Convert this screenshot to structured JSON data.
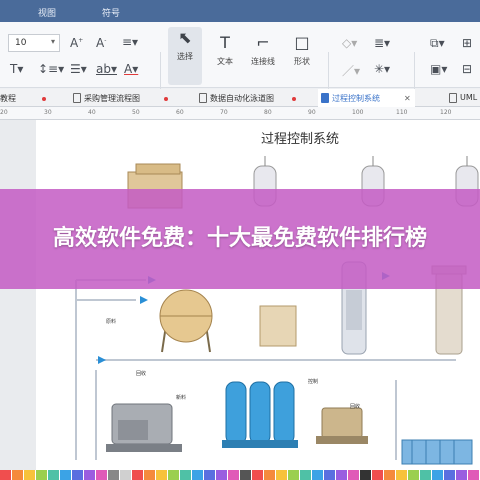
{
  "menu": {
    "items": [
      "视图",
      "符号"
    ]
  },
  "toolbar": {
    "font_size": "10",
    "tools": [
      {
        "label": "选择",
        "icon": "pointer-icon"
      },
      {
        "label": "文本",
        "icon": "text-tool-icon"
      },
      {
        "label": "连接线",
        "icon": "connector-icon"
      },
      {
        "label": "形状",
        "icon": "shape-icon"
      }
    ]
  },
  "tabs": [
    {
      "label": "教程",
      "modified": true
    },
    {
      "label": "采购管理流程图",
      "modified": true
    },
    {
      "label": "数据自动化泳道图",
      "modified": true
    },
    {
      "label": "过程控制系统",
      "active": true
    },
    {
      "label": "UML"
    }
  ],
  "ruler": {
    "ticks": [
      "20",
      "30",
      "40",
      "50",
      "60",
      "70",
      "80",
      "90",
      "100",
      "110",
      "120"
    ]
  },
  "diagram": {
    "title": "过程控制系统",
    "labels": [
      "原料",
      "回收",
      "新料",
      "控制",
      "回收"
    ]
  },
  "banner": {
    "text": "高效软件免费：十大最免费软件排行榜"
  },
  "colors": {
    "menubar": "#4a6b9a",
    "active_tab": "#3a73c9",
    "banner": "#c45cc4",
    "flow_arrow": "#2a8fd6",
    "palette": [
      "#f04e4e",
      "#f58a3c",
      "#f7c23b",
      "#9bcf4e",
      "#4fc1a6",
      "#3ba3e6",
      "#5a6fe0",
      "#9a5de0",
      "#e05ab8",
      "#888888",
      "#d0d0d0",
      "#f04e4e",
      "#f58a3c",
      "#f7c23b",
      "#9bcf4e",
      "#4fc1a6",
      "#3ba3e6",
      "#5a6fe0",
      "#9a5de0",
      "#e05ab8",
      "#555555",
      "#f04e4e",
      "#f58a3c",
      "#f7c23b",
      "#9bcf4e",
      "#4fc1a6",
      "#3ba3e6",
      "#5a6fe0",
      "#9a5de0",
      "#e05ab8",
      "#333333",
      "#f04e4e",
      "#f58a3c",
      "#f7c23b",
      "#9bcf4e",
      "#4fc1a6",
      "#3ba3e6",
      "#5a6fe0",
      "#9a5de0",
      "#e05ab8"
    ]
  }
}
